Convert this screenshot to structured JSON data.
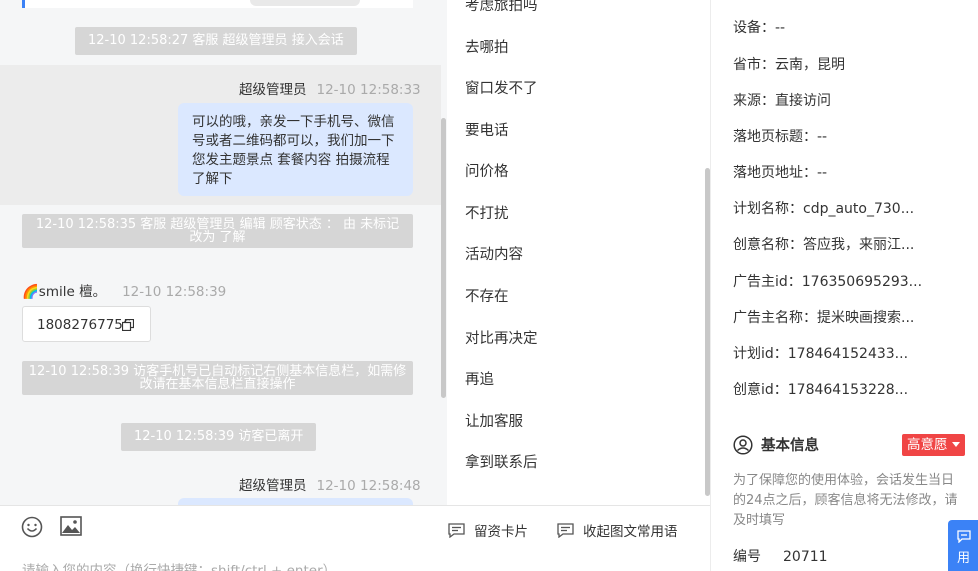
{
  "chat": {
    "system_messages": [
      "12-10 12:58:27 客服 超级管理员 接入会话",
      "12-10 12:58:35 客服 超级管理员 编辑 顾客状态 ： 由 未标记 改为 了解",
      "12-10 12:58:39 访客手机号已自动标记右侧基本信息栏，如需修改请在基本信息栏直接操作",
      "12-10 12:58:39 访客已离开"
    ],
    "agent_message": {
      "sender": "超级管理员",
      "time": "12-10 12:58:33",
      "text": "可以的哦，亲发一下手机号、微信号或者二维码都可以，我们加一下您发主题景点 套餐内容 拍摄流程了解下"
    },
    "visitor_message": {
      "sender": "🌈smile 檀。",
      "time": "12-10 12:58:39",
      "phone": "18082767756"
    },
    "agent_message_2": {
      "sender": "超级管理员",
      "time": "12-10 12:58:48"
    }
  },
  "quick_replies": [
    "考虑旅拍吗",
    "去哪拍",
    "窗口发不了",
    "要电话",
    "问价格",
    "不打扰",
    "活动内容",
    "不存在",
    "对比再决定",
    "再追",
    "让加客服",
    "拿到联系后"
  ],
  "input": {
    "emoji_icon": "smile-icon",
    "image_icon": "image-icon",
    "leave_card_label": "留资卡片",
    "collapse_label": "收起图文常用语",
    "placeholder": "请输入您的内容（换行快捷键：shift/ctrl + enter）"
  },
  "info": {
    "rows": [
      "设备：--",
      "省市：云南，昆明",
      "来源：直接访问",
      "落地页标题：--",
      "落地页地址：--",
      "计划名称：cdp_auto_730...",
      "创意名称：答应我，来丽江...",
      "广告主id：176350695293...",
      "广告主名称：提米映画搜索...",
      "计划id：178464152433...",
      "创意id：178464153228..."
    ],
    "basic_info_title": "基本信息",
    "intent_tag": "高意愿",
    "note": "为了保障您的使用体验，会话发生当日的24点之后，顾客信息将无法修改，请及时填写",
    "serial_label": "编号",
    "serial_value": "20711",
    "float_button": "用"
  },
  "colors": {
    "accent": "#3b82f6",
    "bubble": "#dbe8ff",
    "tag": "#f04545",
    "system": "#d6d6d6"
  }
}
